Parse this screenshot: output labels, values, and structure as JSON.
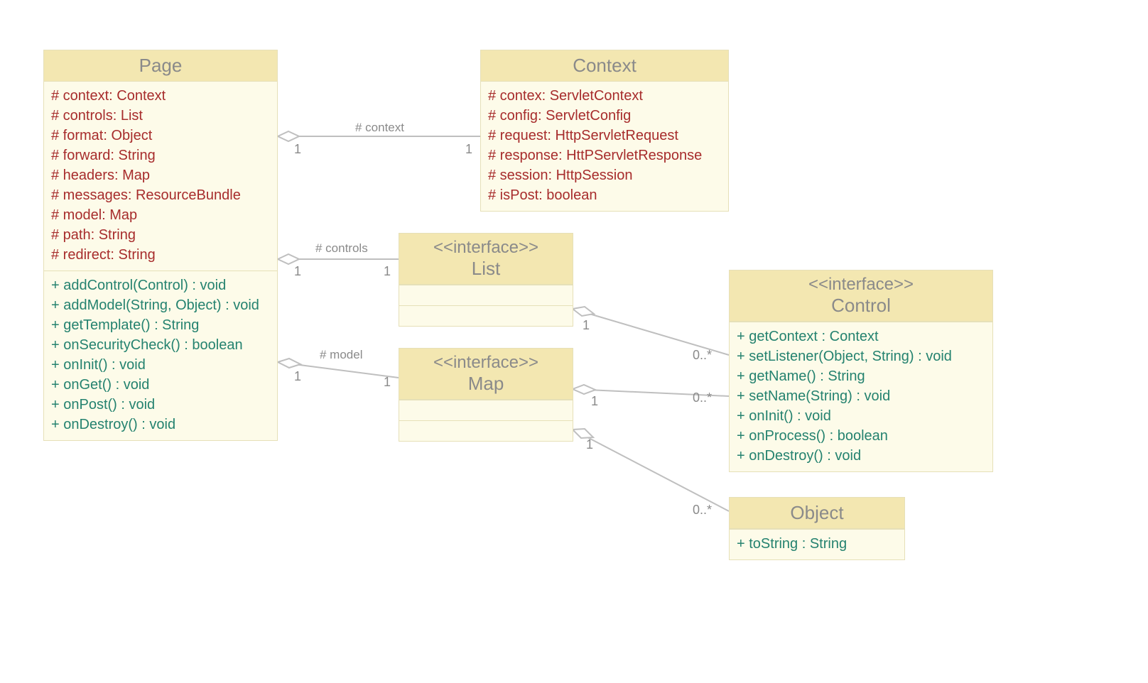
{
  "classes": {
    "page": {
      "name": "Page",
      "attrs": [
        "# context: Context",
        "# controls: List",
        "# format: Object",
        "# forward: String",
        "# headers: Map",
        "# messages: ResourceBundle",
        "# model: Map",
        "# path: String",
        "# redirect: String"
      ],
      "ops": [
        "+ addControl(Control) : void",
        "+ addModel(String, Object) : void",
        "+ getTemplate() : String",
        "+ onSecurityCheck() : boolean",
        "+ onInit() : void",
        "+ onGet() : void",
        "+ onPost() : void",
        "+ onDestroy() : void"
      ]
    },
    "context": {
      "name": "Context",
      "attrs": [
        "# contex: ServletContext",
        "# config: ServletConfig",
        "# request: HttpServletRequest",
        "# response: HttPServletResponse",
        "# session: HttpSession",
        "# isPost: boolean"
      ]
    },
    "list": {
      "stereo": "<<interface>>",
      "name": "List"
    },
    "map": {
      "stereo": "<<interface>>",
      "name": "Map"
    },
    "control": {
      "stereo": "<<interface>>",
      "name": "Control",
      "ops": [
        "+ getContext : Context",
        "+ setListener(Object, String) : void",
        "+ getName() : String",
        "+ setName(String) : void",
        "+ onInit() : void",
        "+ onProcess() : boolean",
        "+ onDestroy() : void"
      ]
    },
    "object": {
      "name": "Object",
      "ops": [
        "+ toString : String"
      ]
    }
  },
  "labels": {
    "context": "# context",
    "controls": "# controls",
    "model": "# model",
    "one": "1",
    "many": "0..*"
  }
}
